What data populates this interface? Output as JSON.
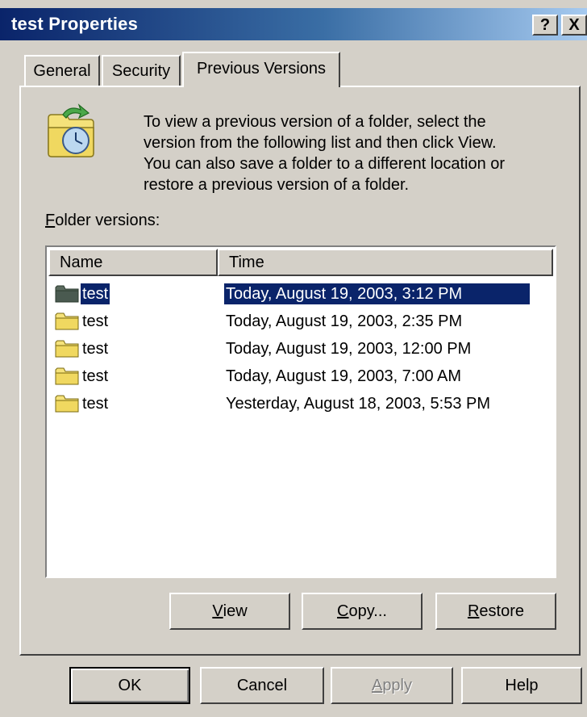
{
  "window": {
    "title": "test Properties",
    "help_btn": "?",
    "close_btn": "X"
  },
  "tabs": [
    {
      "label": "General"
    },
    {
      "label": "Security"
    },
    {
      "label": "Previous Versions"
    }
  ],
  "description": {
    "icon": "restore-folder-icon",
    "lines": [
      "To view a previous version of a folder, select the",
      "version from the following list and then click View.",
      "You can also save a folder to a different location or",
      "restore a previous version of a folder."
    ]
  },
  "versions_label": {
    "accel": "F",
    "rest": "older versions:"
  },
  "list": {
    "columns": [
      "Name",
      "Time"
    ],
    "rows": [
      {
        "name": "test",
        "time": "Today, August 19, 2003, 3:12 PM",
        "selected": true
      },
      {
        "name": "test",
        "time": "Today, August 19, 2003, 2:35 PM"
      },
      {
        "name": "test",
        "time": "Today, August 19, 2003, 12:00 PM"
      },
      {
        "name": "test",
        "time": "Today, August 19, 2003, 7:00 AM"
      },
      {
        "name": "test",
        "time": "Yesterday, August 18, 2003, 5:53 PM"
      }
    ]
  },
  "actions": {
    "view": {
      "accel": "V",
      "rest": "iew"
    },
    "copy": {
      "accel": "C",
      "rest": "opy..."
    },
    "restore": {
      "accel": "R",
      "rest": "estore"
    }
  },
  "footer": {
    "ok": "OK",
    "cancel": "Cancel",
    "apply": {
      "accel": "A",
      "rest": "pply"
    },
    "help": "Help"
  },
  "colors": {
    "face": "#d4d0c8",
    "selection": "#0a246a",
    "folder": "#f5e27a",
    "folder_selected": "#5a6a5e"
  }
}
